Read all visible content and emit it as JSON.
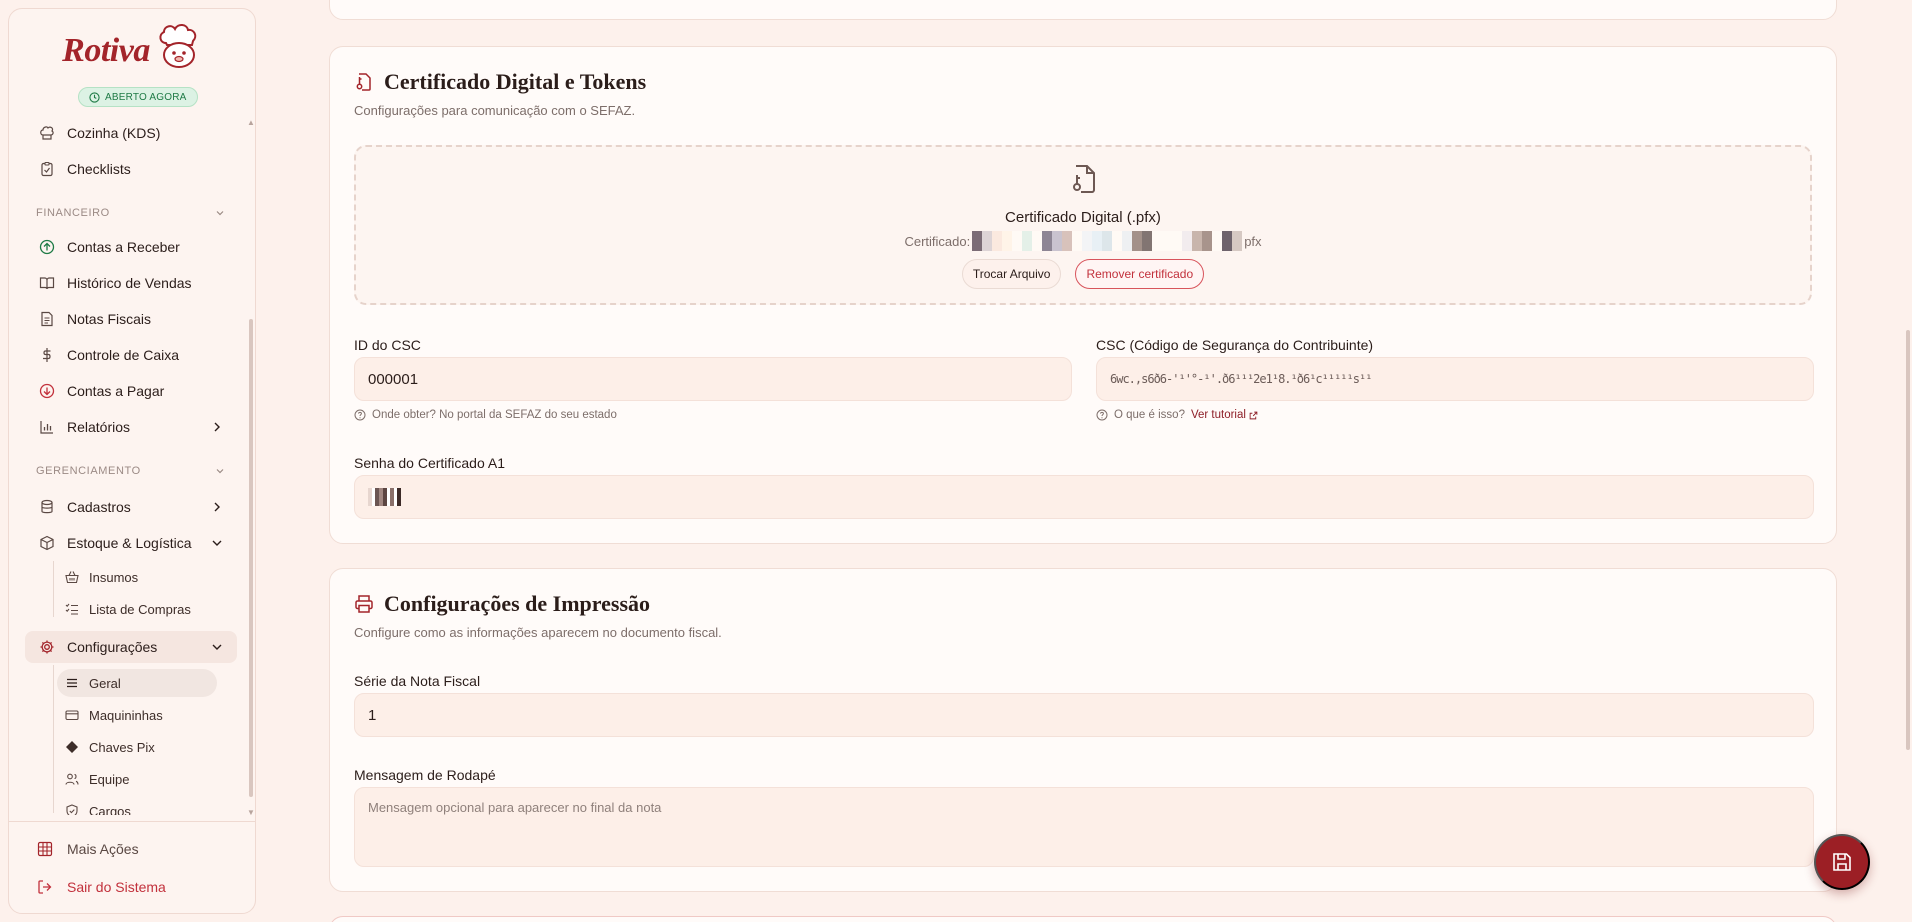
{
  "brand": {
    "name": "Rotiva",
    "status": "ABERTO AGORA"
  },
  "sidebar": {
    "items_top": [
      {
        "label": "Cozinha (KDS)",
        "icon": "chef-hat-icon"
      },
      {
        "label": "Checklists",
        "icon": "clipboard-check-icon"
      }
    ],
    "financeiro": {
      "section": "FINANCEIRO",
      "items": [
        {
          "label": "Contas a Receber",
          "icon": "arrow-up-circle-icon"
        },
        {
          "label": "Histórico de Vendas",
          "icon": "book-open-icon"
        },
        {
          "label": "Notas Fiscais",
          "icon": "file-text-icon"
        },
        {
          "label": "Controle de Caixa",
          "icon": "dollar-icon"
        },
        {
          "label": "Contas a Pagar",
          "icon": "arrow-down-circle-icon"
        },
        {
          "label": "Relatórios",
          "icon": "bar-chart-icon"
        }
      ]
    },
    "gerenciamento": {
      "section": "GERENCIAMENTO",
      "cadastros": "Cadastros",
      "estoque": "Estoque & Logística",
      "estoque_sub": [
        "Insumos",
        "Lista de Compras"
      ],
      "configuracoes": "Configurações",
      "config_sub": [
        "Geral",
        "Maquininhas",
        "Chaves Pix",
        "Equipe",
        "Cargos"
      ]
    },
    "footer": {
      "more": "Mais Ações",
      "exit": "Sair do Sistema"
    }
  },
  "certificado": {
    "title": "Certificado Digital e Tokens",
    "subtitle": "Configurações para comunicação com o SEFAZ.",
    "dropzone_title": "Certificado Digital (.pfx)",
    "file_prefix": "Certificado:",
    "file_suffix": "pfx",
    "change_button": "Trocar Arquivo",
    "remove_button": "Remover certificado",
    "csc_id_label": "ID do CSC",
    "csc_id_value": "000001",
    "csc_id_hint": "Onde obter? No portal da SEFAZ do seu estado",
    "csc_label": "CSC (Código de Segurança do Contribuinte)",
    "csc_value": "6wc.,s6ð6-'¹'°-¹'.ð6¹¹¹2e1¹8.¹ð6¹c¹¹¹¹¹s¹¹",
    "csc_hint": "O que é isso?",
    "csc_tutorial": "Ver tutorial",
    "password_label": "Senha do Certificado A1"
  },
  "impressao": {
    "title": "Configurações de Impressão",
    "subtitle": "Configure como as informações aparecem no documento fiscal.",
    "serie_label": "Série da Nota Fiscal",
    "serie_value": "1",
    "footer_label": "Mensagem de Rodapé",
    "footer_placeholder": "Mensagem opcional para aparecer no final da nota"
  },
  "colors": {
    "accent": "#9c1f25",
    "danger": "#c2313c",
    "success": "#1e7a45"
  },
  "fab": {
    "icon": "save-icon"
  }
}
